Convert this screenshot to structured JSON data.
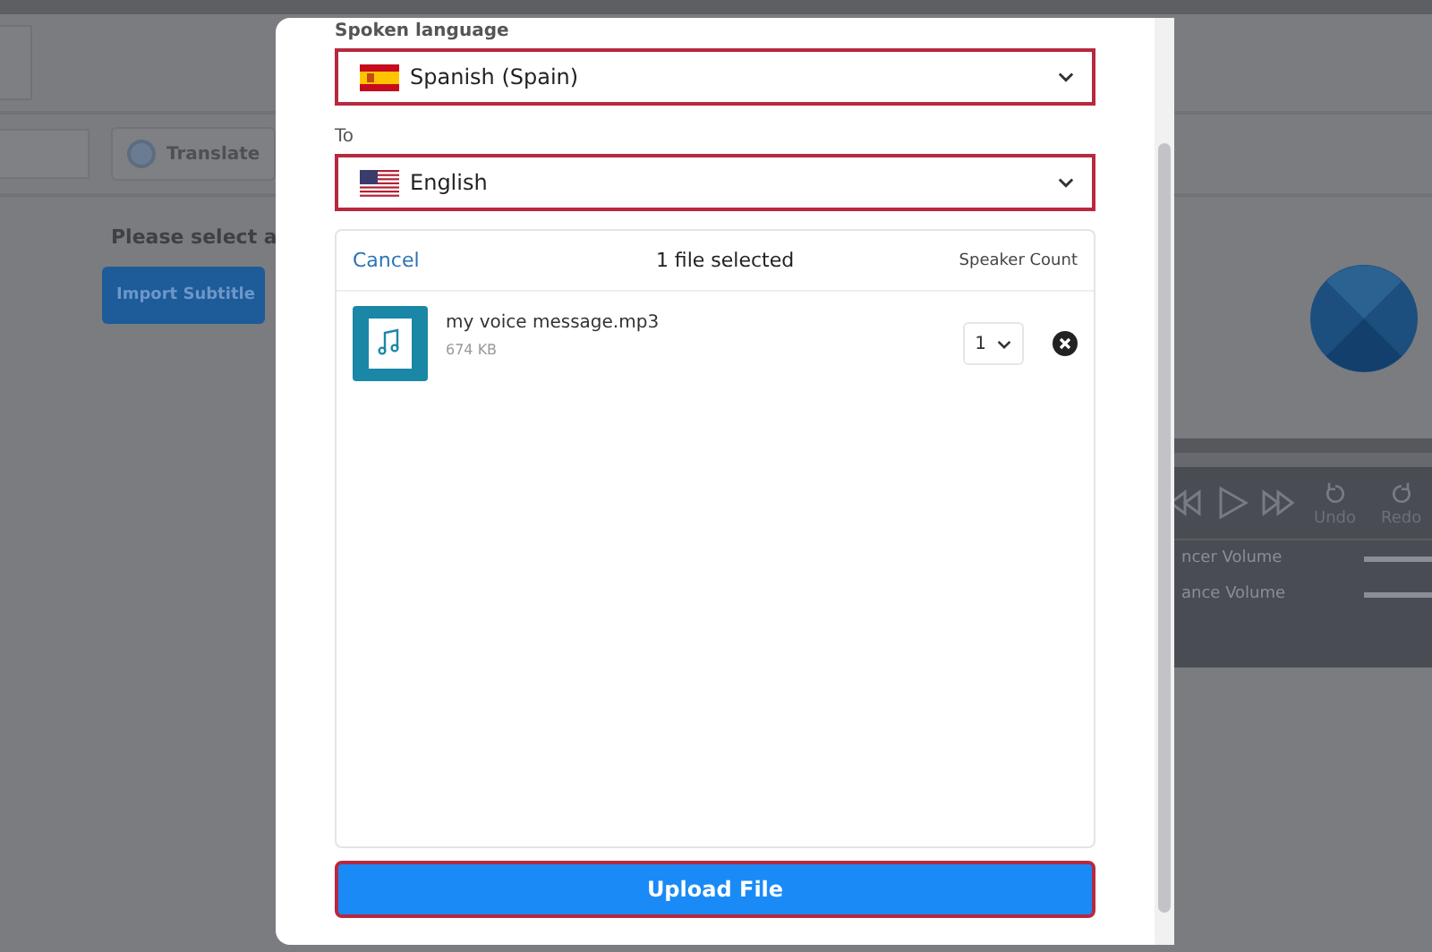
{
  "background": {
    "translate_button": "Translate",
    "prompt": "Please select a",
    "import_button": "Import Subtitle",
    "player": {
      "undo": "Undo",
      "redo": "Redo",
      "volumes": [
        {
          "label": "ncer Volume",
          "level": 1
        },
        {
          "label": "ance Volume",
          "level": 1
        }
      ]
    }
  },
  "dialog": {
    "fields": [
      {
        "label": "Spoken language",
        "value": "Spanish (Spain)",
        "highlighted": true
      },
      {
        "label": "To",
        "value": "English",
        "highlighted": true
      }
    ],
    "files": {
      "cancel": "Cancel",
      "summary": "1 file selected",
      "column": "Speaker Count",
      "items": [
        {
          "name": "my voice message.mp3",
          "size": "674 KB",
          "speaker_count": "1"
        }
      ]
    },
    "upload_button": {
      "label": "Upload File",
      "highlighted": true
    }
  }
}
